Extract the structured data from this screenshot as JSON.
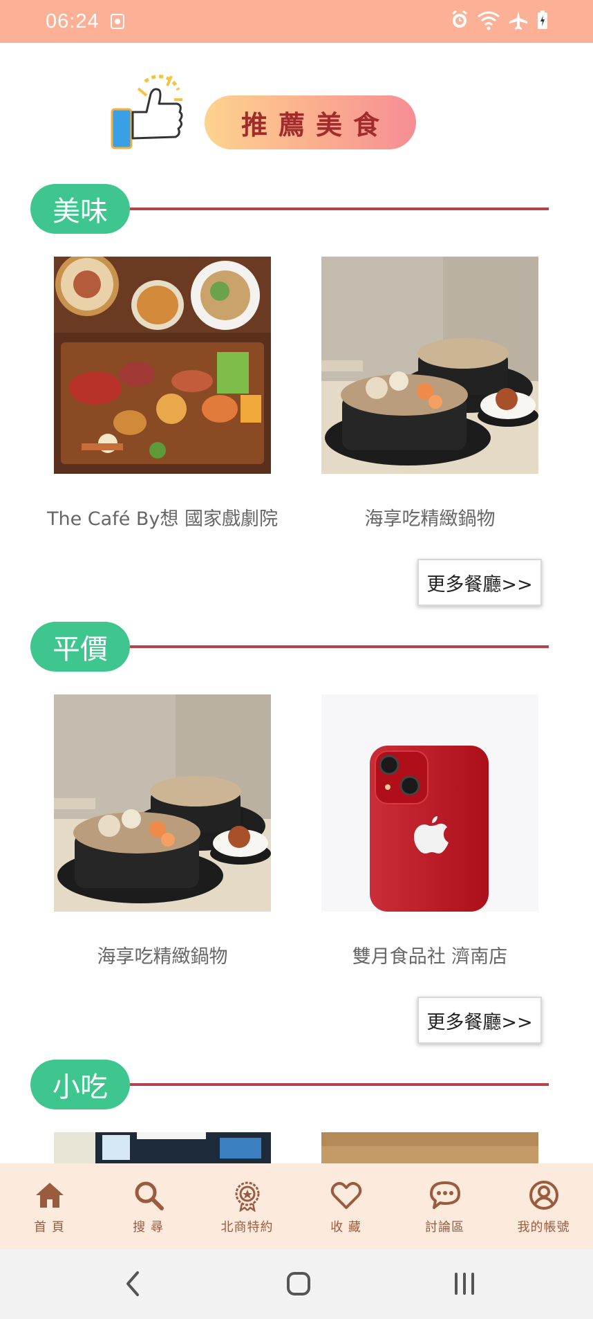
{
  "status_bar": {
    "time": "06:24",
    "icons": [
      "notification-icon",
      "alarm-icon",
      "wifi-icon",
      "airplane-mode-icon",
      "battery-charging-icon"
    ]
  },
  "banner": {
    "title": "推薦美食",
    "icon": "thumbs-up-icon"
  },
  "sections": [
    {
      "tag": "美味",
      "items": [
        {
          "name": "The Café By想 國家戲劇院",
          "image": "food-platter-photo"
        },
        {
          "name": "海享吃精緻鍋物",
          "image": "hotpot-photo"
        }
      ],
      "more_label": "更多餐廳>>"
    },
    {
      "tag": "平價",
      "items": [
        {
          "name": "海享吃精緻鍋物",
          "image": "hotpot-photo"
        },
        {
          "name": "雙月食品社 濟南店",
          "image": "red-phone-photo"
        }
      ],
      "more_label": "更多餐廳>>"
    },
    {
      "tag": "小吃",
      "items": [
        {
          "name": "",
          "image": "storefront-photo"
        },
        {
          "name": "",
          "image": "food-photo"
        }
      ]
    }
  ],
  "bottom_nav": [
    {
      "label": "首 頁",
      "icon": "home-icon"
    },
    {
      "label": "搜 尋",
      "icon": "search-icon"
    },
    {
      "label": "北商特約",
      "icon": "badge-icon"
    },
    {
      "label": "收 藏",
      "icon": "heart-icon"
    },
    {
      "label": "討論區",
      "icon": "chat-icon"
    },
    {
      "label": "我的帳號",
      "icon": "account-icon"
    }
  ],
  "system_nav": [
    "back-icon",
    "home-button-icon",
    "recents-icon"
  ],
  "colors": {
    "status_bar": "#fcb096",
    "section_tag": "#3fc68f",
    "section_line": "#b8424a",
    "bottom_nav_bg": "#fceadc",
    "nav_label": "#9a5b3f"
  }
}
